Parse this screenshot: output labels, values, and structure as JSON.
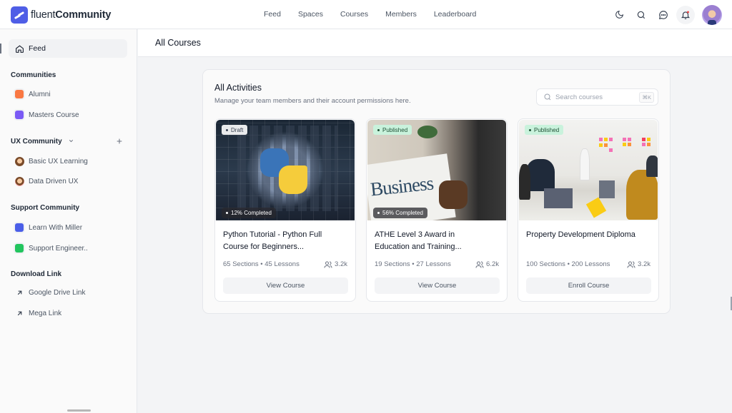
{
  "brand": {
    "name_light": "fluent",
    "name_bold": "Community"
  },
  "nav": {
    "items": [
      "Feed",
      "Spaces",
      "Courses",
      "Members",
      "Leaderboard"
    ]
  },
  "top_icons": [
    "moon-icon",
    "search-icon",
    "chat-icon",
    "bell-icon",
    "avatar"
  ],
  "sidebar": {
    "feed_label": "Feed",
    "sections": [
      {
        "title": "Communities",
        "items": [
          {
            "label": "Alumni",
            "color": "#f97843"
          },
          {
            "label": "Masters Course",
            "color": "#7a5af5"
          }
        ]
      },
      {
        "title": "UX Community",
        "items": [
          {
            "label": "Basic UX Learning"
          },
          {
            "label": "Data Driven UX"
          }
        ]
      },
      {
        "title": "Support Community",
        "items": [
          {
            "label": "Learn With Miller",
            "color": "#4a5ee8"
          },
          {
            "label": "Support Engineer..",
            "color": "#22c55e"
          }
        ]
      },
      {
        "title": "Download Link",
        "items": [
          {
            "label": "Google Drive Link"
          },
          {
            "label": "Mega Link"
          }
        ]
      }
    ]
  },
  "page": {
    "title": "All Courses"
  },
  "panel": {
    "title": "All Activities",
    "subtitle": "Manage your team members and their account permissions here.",
    "search": {
      "placeholder": "Search courses",
      "value": "",
      "shortcut": "⌘K"
    }
  },
  "courses": [
    {
      "status": "Draft",
      "progress_label": "12% Completed",
      "progress": 12,
      "title_line1": "Python Tutorial - Python Full",
      "title_line2": "Course for Beginners...",
      "sections": "65 Sections",
      "lessons": "45 Lessons",
      "meta": "65 Sections • 45 Lessons",
      "members": "3.2k",
      "button": "View Course"
    },
    {
      "status": "Published",
      "progress_label": "56% Completed",
      "progress": 56,
      "title_line1": "ATHE Level 3 Award in",
      "title_line2": "Education and Training...",
      "sections": "19 Sections",
      "lessons": "27 Lessons",
      "meta": "19 Sections • 27 Lessons",
      "members": "6.2k",
      "button": "View Course",
      "image_text": "Business"
    },
    {
      "status": "Published",
      "progress_label": null,
      "title_line1": "Property Development Diploma",
      "title_line2": "",
      "sections": "100 Sections",
      "lessons": "200 Lessons",
      "meta": "100 Sections • 200 Lessons",
      "members": "3.2k",
      "button": "Enroll Course"
    }
  ]
}
